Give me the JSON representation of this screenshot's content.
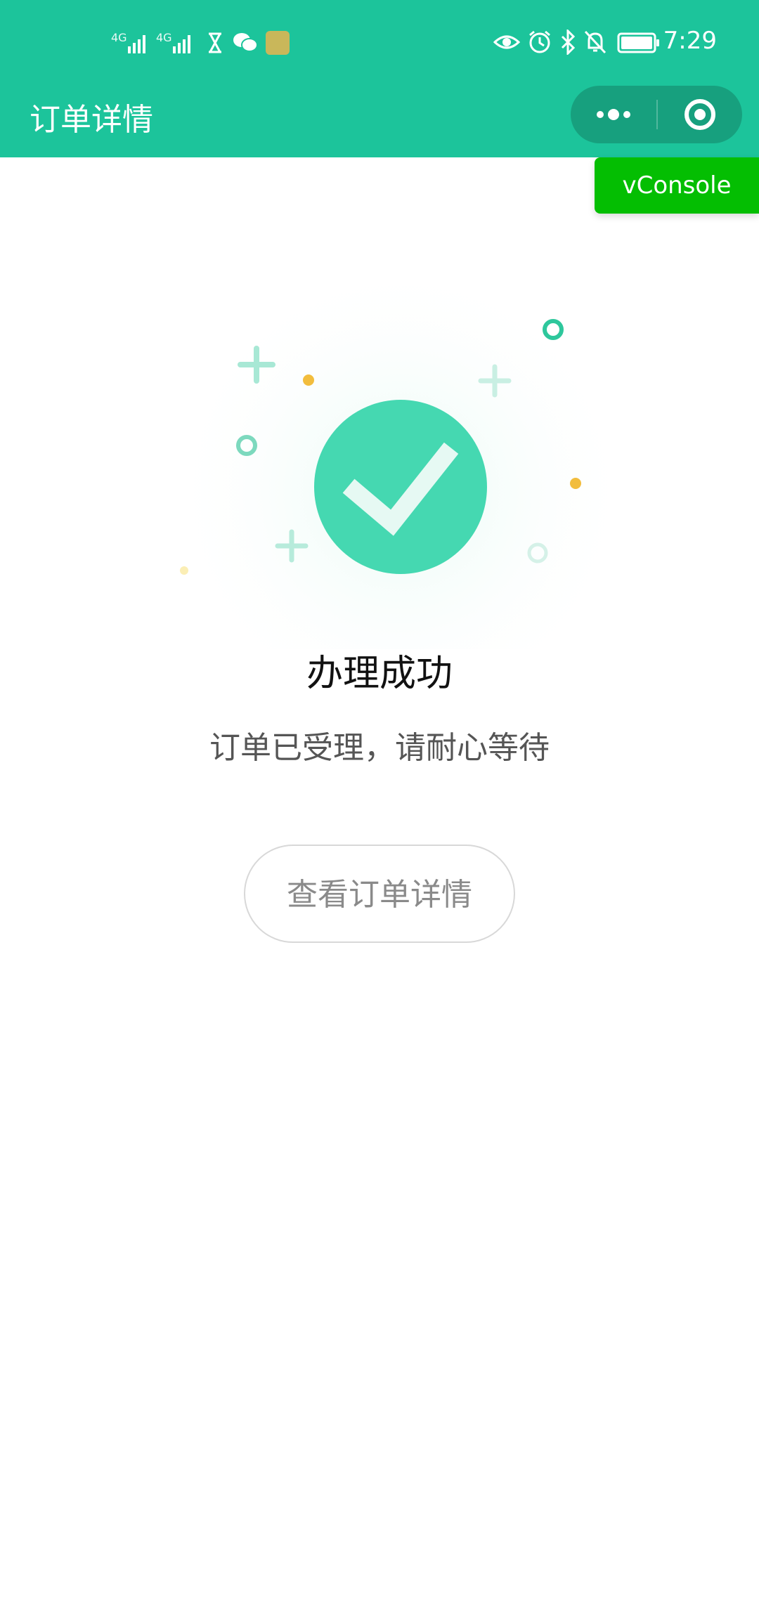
{
  "status_bar": {
    "time": "7:29",
    "signal1_label": "4G",
    "signal2_label": "4G",
    "icons": [
      "signal-icon",
      "signal-icon",
      "hourglass-icon",
      "wechat-icon",
      "app-icon",
      "eye-icon",
      "alarm-icon",
      "bluetooth-icon",
      "mute-bell-icon",
      "battery-icon"
    ]
  },
  "nav": {
    "title": "订单详情",
    "more_icon": "more-dots-icon",
    "close_icon": "close-target-icon"
  },
  "vconsole": {
    "label": "vConsole"
  },
  "result": {
    "title": "办理成功",
    "subtitle": "订单已受理，请耐心等待",
    "icon": "checkmark-circle-icon"
  },
  "actions": {
    "detail_button_label": "查看订单详情"
  },
  "colors": {
    "header_bg": "#1cc49b",
    "capsule_bg": "#17a07e",
    "check_circle": "#45d8b1",
    "vconsole_bg": "#04be02",
    "accent_dot": "#f2bd3d"
  }
}
